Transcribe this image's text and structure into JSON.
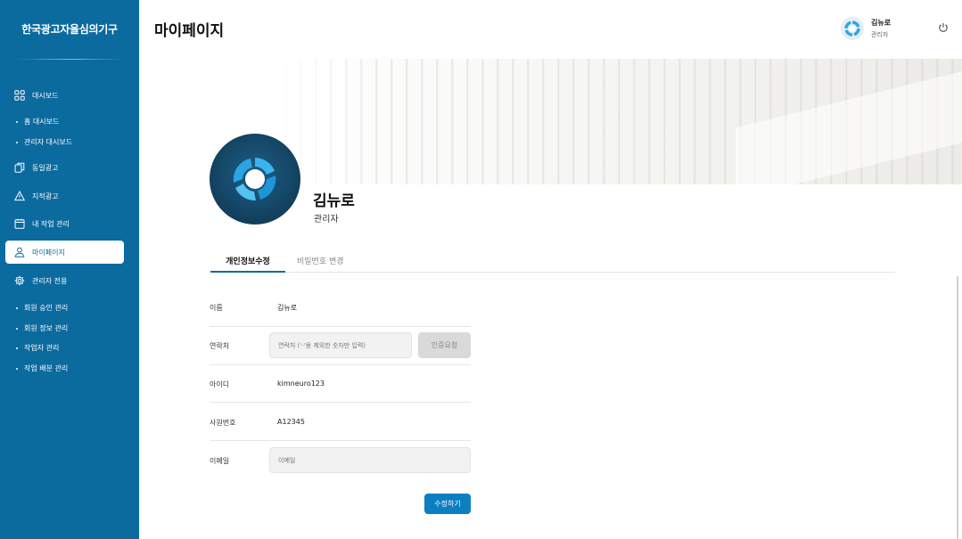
{
  "app": {
    "org_name": "한국광고자율심의기구"
  },
  "sidebar": {
    "items": [
      {
        "label": "대시보드",
        "icon": "grid-icon"
      },
      {
        "label": "동일광고",
        "icon": "copy-icon"
      },
      {
        "label": "지적광고",
        "icon": "warning-icon"
      },
      {
        "label": "내 작업 관리",
        "icon": "calendar-icon"
      },
      {
        "label": "마이페이지",
        "icon": "user-icon",
        "active": true
      },
      {
        "label": "관리자 전용",
        "icon": "gear-icon"
      }
    ],
    "dashboard_sub": [
      "홈 대시보드",
      "관리자 대시보드"
    ],
    "admin_sub": [
      "회원 승인 관리",
      "회원 정보 관리",
      "작업자 관리",
      "작업 배분 관리"
    ]
  },
  "header": {
    "page_title": "마이페이지",
    "user_name": "김뉴로",
    "user_role": "관리자"
  },
  "profile": {
    "name": "김뉴로",
    "role": "관리자"
  },
  "tabs": [
    {
      "label": "개인정보수정",
      "active": true
    },
    {
      "label": "비밀번호 변경",
      "active": false
    }
  ],
  "form": {
    "name_label": "이름",
    "name_value": "김뉴로",
    "phone_label": "연락처",
    "phone_placeholder": "연락처 ('-'용 제외한 숫자만 입력)",
    "verify_button": "인증요청",
    "id_label": "아이디",
    "id_value": "kimneuro123",
    "emp_label": "사원번호",
    "emp_value": "A12345",
    "email_label": "이메일",
    "email_placeholder": "이메일",
    "submit_button": "수정하기"
  },
  "colors": {
    "sidebar_bg": "#0b6a9e",
    "primary": "#0b7fc0",
    "logo_ring": "#29a8e6"
  }
}
